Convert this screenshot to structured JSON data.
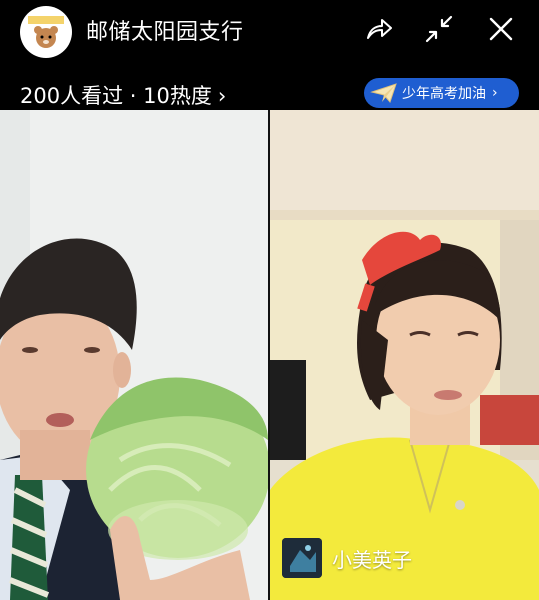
{
  "header": {
    "channel_name": "邮储太阳园支行",
    "stats": "200人看过 · 10热度",
    "stats_chevron": "›",
    "banner_label": "少年高考加油",
    "banner_chevron": "›"
  },
  "participant": {
    "name": "小美英子"
  },
  "colors": {
    "background": "#000000",
    "banner": "#1f5ed1",
    "left_video_bg": "#eef0ef",
    "right_video_bg": "#f2e9c9"
  },
  "icons": [
    "share-icon",
    "collapse-icon",
    "close-icon",
    "paper-plane-icon"
  ]
}
